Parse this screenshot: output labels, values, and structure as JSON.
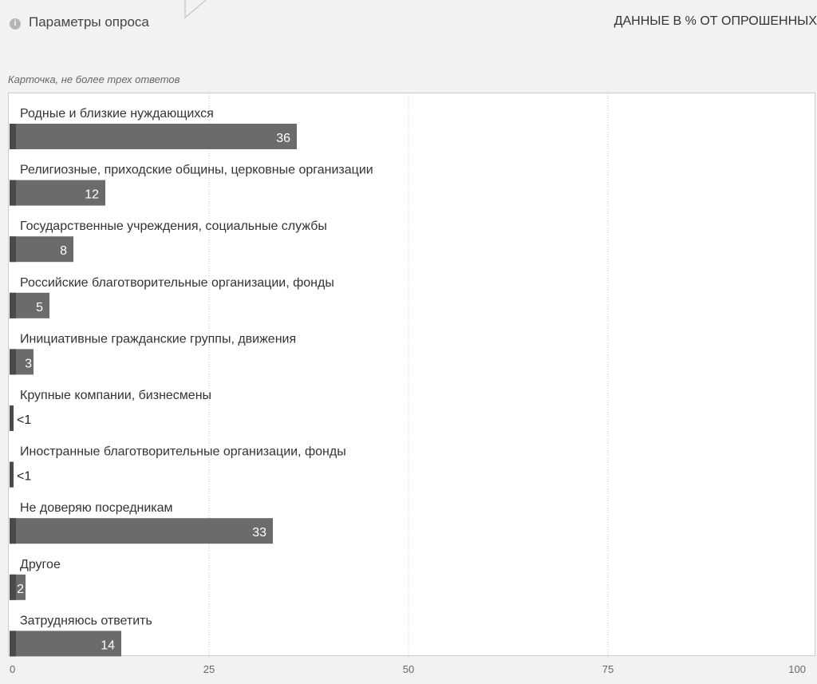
{
  "header": {
    "params_label": "Параметры опроса",
    "info_icon": "info-icon",
    "units": "ДАННЫЕ В % ОТ ОПРОШЕННЫХ"
  },
  "note": "Карточка, не более трех ответов",
  "colors": {
    "bar": "#6b6b6b",
    "bar_accent": "#4a4a4a",
    "grid": "#c8c8c8"
  },
  "chart_data": {
    "type": "bar",
    "orientation": "horizontal",
    "categories": [
      "Родные и близкие нуждающихся",
      "Религиозные, приходские общины, церковные организации",
      "Государственные учреждения, социальные службы",
      "Российские благотворительные организации, фонды",
      "Инициативные гражданские группы, движения",
      "Крупные компании, бизнесмены",
      "Иностранные благотворительные организации, фонды",
      "Не доверяю посредникам",
      "Другое",
      "Затрудняюсь ответить"
    ],
    "values": [
      36,
      12,
      8,
      5,
      3,
      0.5,
      0.5,
      33,
      2,
      14
    ],
    "labels": [
      "36",
      "12",
      "8",
      "5",
      "3",
      "<1",
      "<1",
      "33",
      "2",
      "14"
    ],
    "xlim": [
      0,
      100
    ],
    "xticks": [
      "0",
      "25",
      "50",
      "75",
      "100"
    ],
    "grid": true
  }
}
